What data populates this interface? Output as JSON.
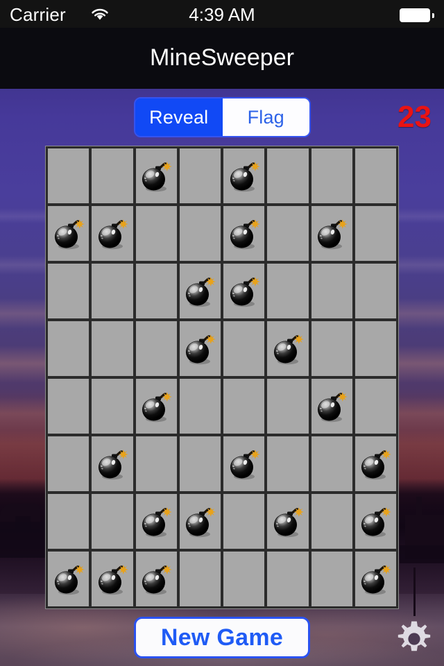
{
  "status_bar": {
    "carrier": "Carrier",
    "wifi_icon": "wifi-icon",
    "time": "4:39 AM",
    "battery_icon": "battery-full-icon"
  },
  "nav": {
    "title": "MineSweeper"
  },
  "toolbar": {
    "mode_control": {
      "name": "mode-segmented-control",
      "options": [
        "Reveal",
        "Flag"
      ],
      "selected": "Reveal",
      "selected_index": 0
    },
    "mine_counter": {
      "value": "23",
      "color": "#ea1313"
    }
  },
  "board": {
    "rows": 8,
    "cols": 8,
    "cell_color": "#a8a8a8",
    "grid_line_color": "#2b2b2b",
    "mine_icon": "bomb-icon",
    "mine_count": 23,
    "cells": [
      [
        "empty",
        "empty",
        "mine",
        "empty",
        "mine",
        "empty",
        "empty",
        "empty"
      ],
      [
        "mine",
        "mine",
        "empty",
        "empty",
        "mine",
        "empty",
        "mine",
        "empty"
      ],
      [
        "empty",
        "empty",
        "empty",
        "mine",
        "mine",
        "empty",
        "empty",
        "empty"
      ],
      [
        "empty",
        "empty",
        "empty",
        "mine",
        "empty",
        "mine",
        "empty",
        "empty"
      ],
      [
        "empty",
        "empty",
        "mine",
        "empty",
        "empty",
        "empty",
        "mine",
        "empty"
      ],
      [
        "empty",
        "mine",
        "empty",
        "empty",
        "mine",
        "empty",
        "empty",
        "mine"
      ],
      [
        "empty",
        "empty",
        "mine",
        "mine",
        "empty",
        "mine",
        "empty",
        "mine"
      ],
      [
        "mine",
        "mine",
        "mine",
        "empty",
        "empty",
        "empty",
        "empty",
        "mine"
      ]
    ]
  },
  "footer": {
    "new_game_label": "New Game",
    "settings_icon": "gear-icon"
  },
  "theme": {
    "accent_blue": "#1149f5",
    "counter_red": "#ea1313",
    "nav_bg": "#0b0b10",
    "status_bg": "#131313"
  }
}
